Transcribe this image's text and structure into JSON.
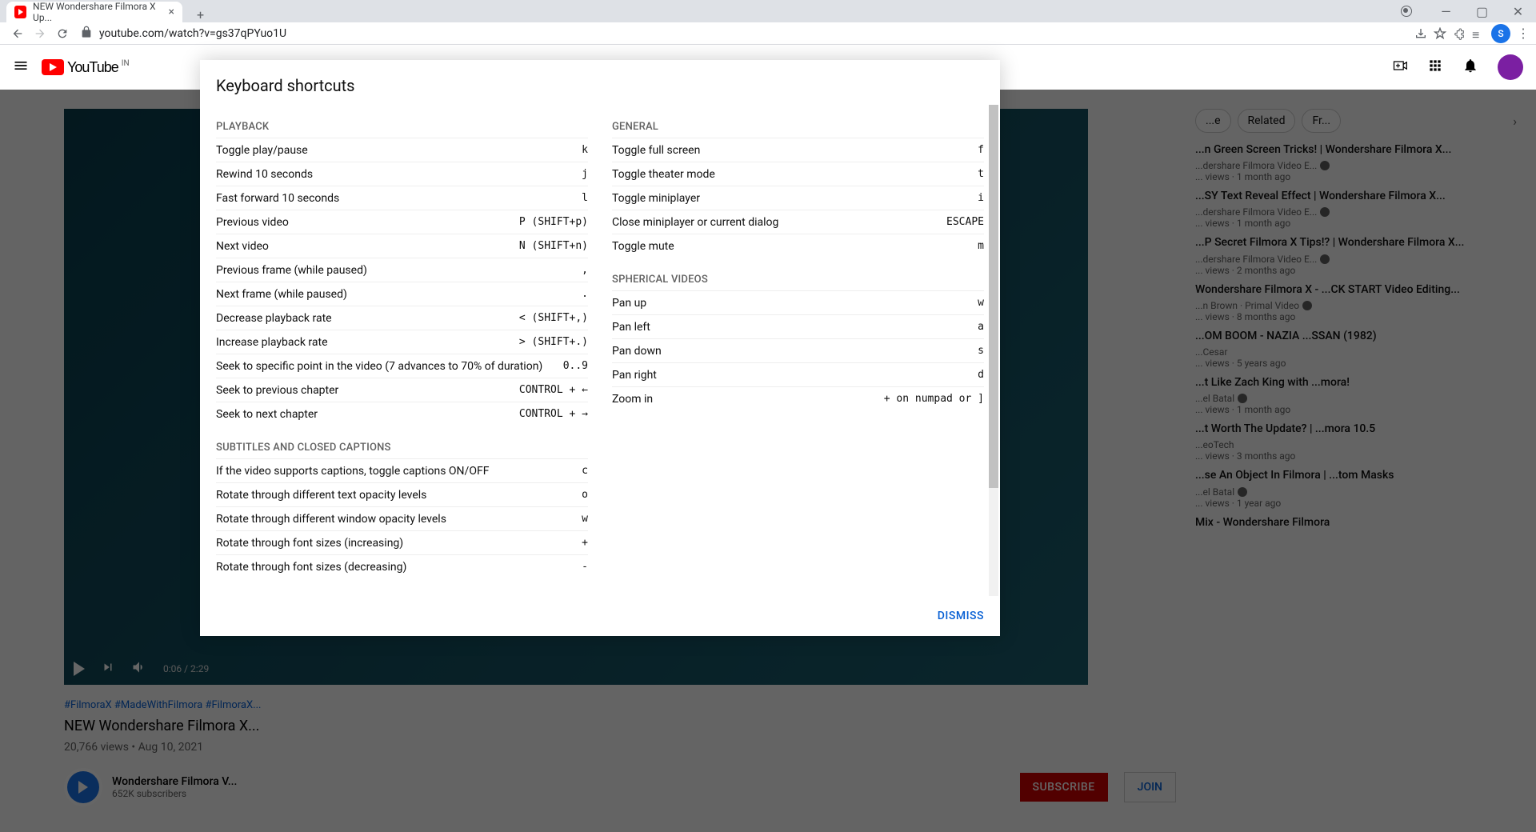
{
  "browser": {
    "tab_title": "NEW Wondershare Filmora X Up...",
    "url": "youtube.com/watch?v=gs37qPYuo1U",
    "avatar_letter": "S"
  },
  "youtube": {
    "logo_text": "YouTube",
    "logo_region": "IN",
    "player_time": "0:06 / 2:29",
    "tags": "#FilmoraX #MadeWithFilmora #FilmoraX...",
    "video_title": "NEW Wondershare Filmora X...",
    "views": "20,766 views",
    "date": "Aug 10, 2021",
    "channel_name": "Wondershare Filmora V...",
    "subscribers": "652K subscribers",
    "subscribe": "SUBSCRIBE",
    "join": "JOIN",
    "chips": [
      "...e",
      "Related",
      "Fr..."
    ],
    "suggestions": [
      {
        "title": "...n Green Screen Tricks! | Wondershare Filmora X...",
        "channel": "...dershare Filmora Video E...",
        "verified": true,
        "meta": "... views · 1 month ago"
      },
      {
        "title": "...SY Text Reveal Effect | Wondershare Filmora X...",
        "channel": "...dershare Filmora Video E...",
        "verified": true,
        "meta": "... views · 1 month ago"
      },
      {
        "title": "...P Secret Filmora X Tips!? | Wondershare Filmora X...",
        "channel": "...dershare Filmora Video E...",
        "verified": true,
        "meta": "... views · 2 months ago"
      },
      {
        "title": "Wondershare Filmora X - ...CK START Video Editing...",
        "channel": "...n Brown · Primal Video",
        "verified": true,
        "meta": "... views · 8 months ago"
      },
      {
        "title": "...OM BOOM - NAZIA ...SSAN (1982)",
        "channel": "...Cesar",
        "verified": false,
        "meta": "... views · 5 years ago"
      },
      {
        "title": "...t Like Zach King with ...mora!",
        "channel": "...el Batal",
        "verified": true,
        "meta": "... views · 1 month ago"
      },
      {
        "title": "...t Worth The Update? | ...mora 10.5",
        "channel": "...eoTech",
        "verified": false,
        "meta": "... views · 3 months ago"
      },
      {
        "title": "...se An Object In Filmora | ...tom Masks",
        "channel": "...el Batal",
        "verified": true,
        "meta": "... views · 1 year ago"
      },
      {
        "title": "Mix - Wondershare Filmora",
        "channel": "",
        "verified": false,
        "meta": ""
      }
    ]
  },
  "dialog": {
    "title": "Keyboard shortcuts",
    "dismiss": "DISMISS",
    "sections_left": [
      {
        "title": "PLAYBACK",
        "rows": [
          {
            "label": "Toggle play/pause",
            "key": "k"
          },
          {
            "label": "Rewind 10 seconds",
            "key": "j"
          },
          {
            "label": "Fast forward 10 seconds",
            "key": "l"
          },
          {
            "label": "Previous video",
            "key": "P (SHIFT+p)"
          },
          {
            "label": "Next video",
            "key": "N (SHIFT+n)"
          },
          {
            "label": "Previous frame (while paused)",
            "key": ","
          },
          {
            "label": "Next frame (while paused)",
            "key": "."
          },
          {
            "label": "Decrease playback rate",
            "key": "< (SHIFT+,)"
          },
          {
            "label": "Increase playback rate",
            "key": "> (SHIFT+.)"
          },
          {
            "label": "Seek to specific point in the video (7 advances to 70% of duration)",
            "key": "0..9"
          },
          {
            "label": "Seek to previous chapter",
            "key": "CONTROL + ←"
          },
          {
            "label": "Seek to next chapter",
            "key": "CONTROL + →"
          }
        ]
      },
      {
        "title": "SUBTITLES AND CLOSED CAPTIONS",
        "rows": [
          {
            "label": "If the video supports captions, toggle captions ON/OFF",
            "key": "c"
          },
          {
            "label": "Rotate through different text opacity levels",
            "key": "o"
          },
          {
            "label": "Rotate through different window opacity levels",
            "key": "w"
          },
          {
            "label": "Rotate through font sizes (increasing)",
            "key": "+"
          },
          {
            "label": "Rotate through font sizes (decreasing)",
            "key": "-"
          }
        ]
      }
    ],
    "sections_right": [
      {
        "title": "GENERAL",
        "rows": [
          {
            "label": "Toggle full screen",
            "key": "f"
          },
          {
            "label": "Toggle theater mode",
            "key": "t"
          },
          {
            "label": "Toggle miniplayer",
            "key": "i"
          },
          {
            "label": "Close miniplayer or current dialog",
            "key": "ESCAPE"
          },
          {
            "label": "Toggle mute",
            "key": "m"
          }
        ]
      },
      {
        "title": "SPHERICAL VIDEOS",
        "rows": [
          {
            "label": "Pan up",
            "key": "w"
          },
          {
            "label": "Pan left",
            "key": "a"
          },
          {
            "label": "Pan down",
            "key": "s"
          },
          {
            "label": "Pan right",
            "key": "d"
          },
          {
            "label": "Zoom in",
            "key": "+ on numpad or ]"
          }
        ]
      }
    ]
  }
}
